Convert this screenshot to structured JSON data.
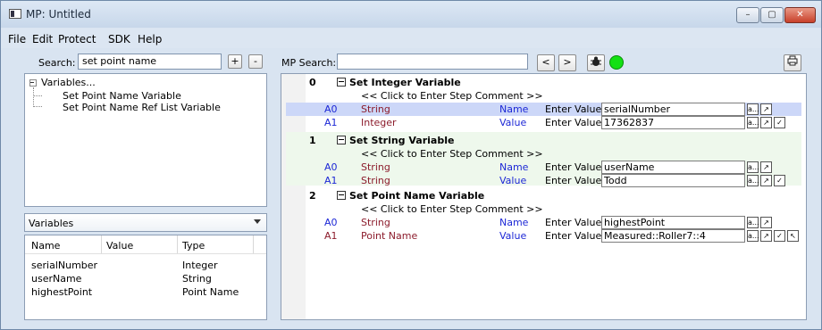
{
  "window": {
    "title": "MP: Untitled",
    "controls": [
      "–",
      "▢",
      "✕"
    ]
  },
  "menu": [
    {
      "label": "File"
    },
    {
      "label": "Edit"
    },
    {
      "label": "Protect"
    },
    {
      "label": "SDK"
    },
    {
      "label": "Help"
    }
  ],
  "left": {
    "search_label": "Search:",
    "search_value": "set point name",
    "plus": "+",
    "minus": "-",
    "tree": {
      "root": "Variables...",
      "children": [
        "Set Point Name Variable",
        "Set Point Name Ref List Variable"
      ]
    },
    "combo_value": "Variables",
    "columns": [
      "Name",
      "Value",
      "Type"
    ],
    "rows": [
      {
        "name": "serialNumber",
        "value": "",
        "type": "Integer"
      },
      {
        "name": "userName",
        "value": "",
        "type": "String"
      },
      {
        "name": "highestPoint",
        "value": "",
        "type": "Point Name"
      }
    ]
  },
  "right": {
    "search_label": "MP Search:",
    "search_value": "",
    "nav_prev": "<",
    "nav_next": ">",
    "steps": [
      {
        "number": "0",
        "title": "Set Integer Variable",
        "comment": "<< Click to Enter Step Comment >>",
        "args": [
          {
            "id": "A0",
            "type": "String",
            "kind": "Name",
            "action": "Enter Value",
            "value": "serialNumber",
            "buttons": [
              "a...",
              "↗"
            ]
          },
          {
            "id": "A1",
            "type": "Integer",
            "kind": "Value",
            "action": "Enter Value",
            "value": "17362837",
            "buttons": [
              "a...",
              "↗",
              "✓"
            ]
          }
        ]
      },
      {
        "number": "1",
        "title": "Set String Variable",
        "comment": "<< Click to Enter Step Comment >>",
        "args": [
          {
            "id": "A0",
            "type": "String",
            "kind": "Name",
            "action": "Enter Value",
            "value": "userName",
            "buttons": [
              "a...",
              "↗"
            ]
          },
          {
            "id": "A1",
            "type": "String",
            "kind": "Value",
            "action": "Enter Value",
            "value": "Todd",
            "buttons": [
              "a...",
              "↗",
              "✓"
            ]
          }
        ]
      },
      {
        "number": "2",
        "title": "Set Point Name Variable",
        "comment": "<< Click to Enter Step Comment >>",
        "args": [
          {
            "id": "A0",
            "type": "String",
            "kind": "Name",
            "action": "Enter Value",
            "value": "highestPoint",
            "buttons": [
              "a...",
              "↗"
            ]
          },
          {
            "id": "A1",
            "type": "Point Name",
            "kind": "Value",
            "action": "Enter Value",
            "value": "Measured::Roller7::4",
            "buttons": [
              "a...",
              "↗",
              "✓",
              "↖"
            ]
          }
        ]
      }
    ]
  },
  "colors": {
    "link_blue": "#1d28d6",
    "dark_red": "#8c1c2c",
    "selection": "#ccd7f8",
    "step_bg": "#eef8ec"
  }
}
